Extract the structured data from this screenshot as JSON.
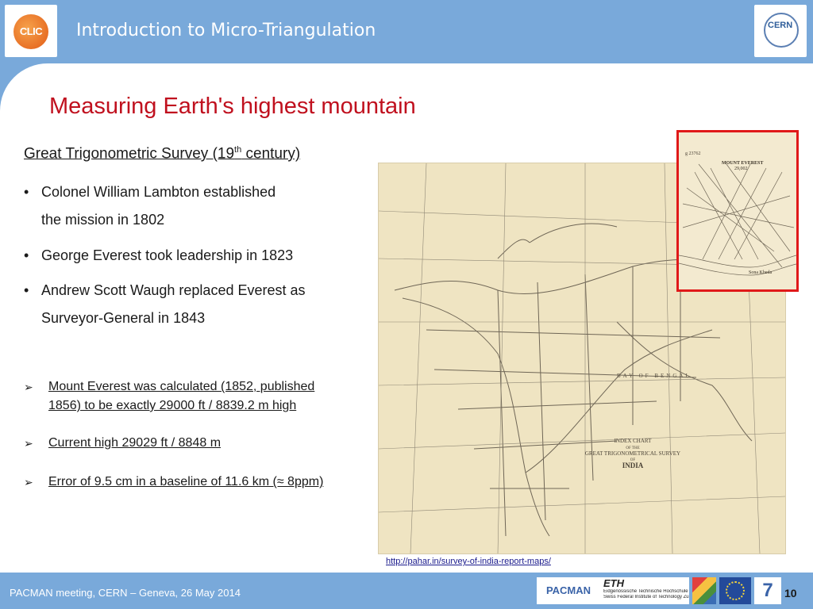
{
  "header": {
    "title": "Introduction to Micro-Triangulation",
    "logo_left_text": "CLIC",
    "logo_right_text": "CERN"
  },
  "slide": {
    "title": "Measuring Earth's highest mountain",
    "section_heading_pre": "Great Trigonometric Survey (19",
    "section_heading_sup": "th",
    "section_heading_post": " century)",
    "bullets": [
      {
        "line1": "Colonel William Lambton established",
        "line2": "the mission in 1802"
      },
      {
        "line1": "George Everest took leadership in 1823",
        "line2": ""
      },
      {
        "line1": "Andrew Scott Waugh replaced Everest as",
        "line2": "Surveyor-General in 1843"
      }
    ],
    "bullet_char": "•",
    "arrow_char": "➢",
    "arrow_items": [
      {
        "line1": "Mount Everest was calculated (1852, published",
        "line2": "1856) to be exactly 29000 ft / 8839.2 m high"
      },
      {
        "line1": "Current high 29029 ft / 8848 m",
        "line2": ""
      },
      {
        "line1": "Error of 9.5 cm in a baseline of 11.6 km (≈ 8ppm)",
        "line2": ""
      }
    ]
  },
  "map": {
    "index_chart_lines": [
      "INDEX CHART",
      "OF THE",
      "GREAT TRIGONOMETRICAL SURVEY",
      "OF",
      "INDIA"
    ],
    "bay_label": "BAY OF BENGAL",
    "inset_label": "MOUNT EVEREST",
    "inset_value": "29,002",
    "inset_corner": "g 23762",
    "inset_bottom": "Sona Kheda",
    "url": "http://pahar.in/survey-of-india-report-maps/"
  },
  "footer": {
    "text": "PACMAN meeting, CERN – Geneva, 26 May 2014",
    "page_number": "10",
    "pacman_logo": "PACMAN",
    "eth_logo": "ETH",
    "eth_sub1": "Eidgenössische Technische Hochschule Zürich",
    "eth_sub2": "Swiss Federal Institute of Technology Zurich",
    "fp7_logo": "7"
  }
}
